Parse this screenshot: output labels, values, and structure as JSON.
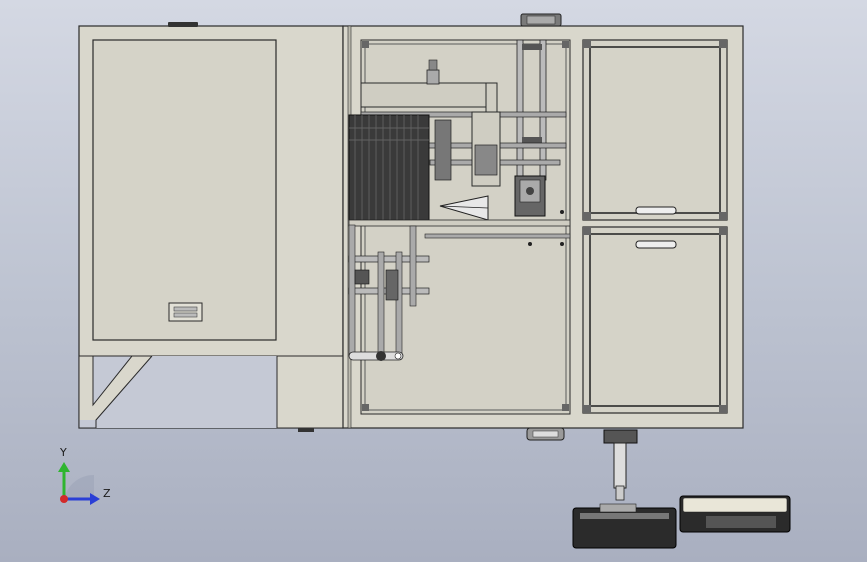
{
  "viewport": {
    "background_top": "#d4d8e3",
    "background_bottom": "#a9afc0"
  },
  "model": {
    "body_color": "#d9d7cc",
    "edge_color": "#2a2a2a",
    "frame_color": "#9c9c9c",
    "part_dark": "#2b2b2b"
  },
  "triad": {
    "y_label": "Y",
    "z_label": "Z",
    "y_color": "#2fb52f",
    "z_color": "#2a3fd6",
    "x_color": "#d22a2a"
  }
}
